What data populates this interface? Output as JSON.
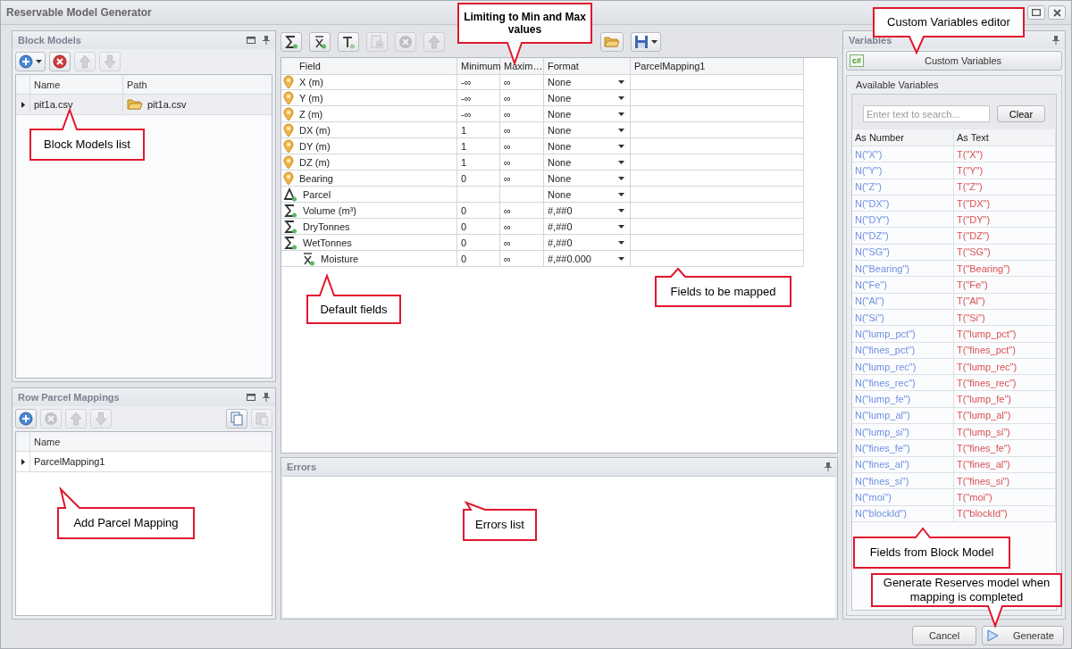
{
  "window": {
    "title": "Reservable Model Generator"
  },
  "block_models": {
    "title": "Block Models",
    "toolbar": [
      {
        "kind": "add",
        "dropdown": true,
        "disabled": false
      },
      {
        "kind": "delete",
        "disabled": false
      },
      {
        "kind": "up",
        "disabled": true
      },
      {
        "kind": "down",
        "disabled": true
      }
    ],
    "columns": [
      "Name",
      "Path"
    ],
    "rows": [
      {
        "name": "pit1a.csv",
        "path": "pit1a.csv",
        "selected": true
      }
    ]
  },
  "parcel_mappings": {
    "title": "Row Parcel Mappings",
    "toolbar": [
      {
        "kind": "add",
        "disabled": false
      },
      {
        "kind": "remove",
        "disabled": true
      },
      {
        "kind": "up",
        "disabled": true
      },
      {
        "kind": "down",
        "disabled": true
      },
      {
        "kind": "copy",
        "disabled": false
      },
      {
        "kind": "paste",
        "disabled": true
      }
    ],
    "columns": [
      "Name"
    ],
    "rows": [
      {
        "name": "ParcelMapping1",
        "selected": true
      }
    ]
  },
  "mapping_toolbar": [
    {
      "kind": "sigma",
      "disabled": false
    },
    {
      "kind": "formula",
      "disabled": false
    },
    {
      "kind": "text",
      "disabled": false
    },
    {
      "kind": "add-field",
      "disabled": true
    },
    {
      "kind": "remove",
      "disabled": true
    },
    {
      "kind": "up",
      "disabled": true
    },
    {
      "kind": "folder",
      "disabled": false
    },
    {
      "kind": "save",
      "dropdown": true,
      "disabled": false
    }
  ],
  "field_grid": {
    "columns": [
      "Field",
      "Minimum",
      "Maxim…",
      "Format",
      "ParcelMapping1"
    ],
    "rows": [
      {
        "kind": "location",
        "field": "X (m)",
        "minimum": "-∞",
        "maximum": "∞",
        "format": "None"
      },
      {
        "kind": "location",
        "field": "Y (m)",
        "minimum": "-∞",
        "maximum": "∞",
        "format": "None"
      },
      {
        "kind": "location",
        "field": "Z (m)",
        "minimum": "-∞",
        "maximum": "∞",
        "format": "None"
      },
      {
        "kind": "location",
        "field": "DX (m)",
        "minimum": "1",
        "maximum": "∞",
        "format": "None"
      },
      {
        "kind": "location",
        "field": "DY (m)",
        "minimum": "1",
        "maximum": "∞",
        "format": "None"
      },
      {
        "kind": "location",
        "field": "DZ (m)",
        "minimum": "1",
        "maximum": "∞",
        "format": "None"
      },
      {
        "kind": "location",
        "field": "Bearing",
        "minimum": "0",
        "maximum": "∞",
        "format": "None"
      },
      {
        "kind": "delta",
        "field": "Parcel",
        "format": "None"
      },
      {
        "kind": "sigma",
        "field": "Volume (m³)",
        "minimum": "0",
        "maximum": "∞",
        "format": "#,##0"
      },
      {
        "kind": "sigma",
        "field": "DryTonnes",
        "minimum": "0",
        "maximum": "∞",
        "format": "#,##0"
      },
      {
        "kind": "sigma",
        "field": "WetTonnes",
        "minimum": "0",
        "maximum": "∞",
        "format": "#,##0",
        "children": [
          {
            "kind": "formula",
            "field": "Moisture",
            "minimum": "0",
            "maximum": "∞",
            "format": "#,##0.000"
          }
        ]
      }
    ]
  },
  "errors": {
    "title": "Errors"
  },
  "variables": {
    "title": "Variables",
    "custom_button": "Custom Variables",
    "custom_button_icon": "c#",
    "available_title": "Available Variables",
    "search": {
      "placeholder": "Enter text to search..."
    },
    "clear_button": "Clear",
    "columns": [
      "As Number",
      "As Text"
    ],
    "rows": [
      {
        "number": "N(\"X\")",
        "text": "T(\"X\")"
      },
      {
        "number": "N(\"Y\")",
        "text": "T(\"Y\")"
      },
      {
        "number": "N(\"Z\")",
        "text": "T(\"Z\")"
      },
      {
        "number": "N(\"DX\")",
        "text": "T(\"DX\")"
      },
      {
        "number": "N(\"DY\")",
        "text": "T(\"DY\")"
      },
      {
        "number": "N(\"DZ\")",
        "text": "T(\"DZ\")"
      },
      {
        "number": "N(\"SG\")",
        "text": "T(\"SG\")"
      },
      {
        "number": "N(\"Bearing\")",
        "text": "T(\"Bearing\")"
      },
      {
        "number": "N(\"Fe\")",
        "text": "T(\"Fe\")"
      },
      {
        "number": "N(\"Al\")",
        "text": "T(\"Al\")"
      },
      {
        "number": "N(\"Si\")",
        "text": "T(\"Si\")"
      },
      {
        "number": "N(\"lump_pct\")",
        "text": "T(\"lump_pct\")"
      },
      {
        "number": "N(\"fines_pct\")",
        "text": "T(\"fines_pct\")"
      },
      {
        "number": "N(\"lump_rec\")",
        "text": "T(\"lump_rec\")"
      },
      {
        "number": "N(\"fines_rec\")",
        "text": "T(\"fines_rec\")"
      },
      {
        "number": "N(\"lump_fe\")",
        "text": "T(\"lump_fe\")"
      },
      {
        "number": "N(\"lump_al\")",
        "text": "T(\"lump_al\")"
      },
      {
        "number": "N(\"lump_si\")",
        "text": "T(\"lump_si\")"
      },
      {
        "number": "N(\"fines_fe\")",
        "text": "T(\"fines_fe\")"
      },
      {
        "number": "N(\"fines_al\")",
        "text": "T(\"fines_al\")"
      },
      {
        "number": "N(\"fines_si\")",
        "text": "T(\"fines_si\")"
      },
      {
        "number": "N(\"moi\")",
        "text": "T(\"moi\")"
      },
      {
        "number": "N(\"blockId\")",
        "text": "T(\"blockId\")"
      }
    ]
  },
  "footer": {
    "buttons": [
      {
        "label": "Cancel",
        "kind": "plain"
      },
      {
        "label": "Generate",
        "kind": "run"
      }
    ]
  },
  "callouts": [
    "Limiting to Min and Max values",
    "Custom Variables editor",
    "Block Models list",
    "Default fields",
    "Fields to be mapped",
    "Add Parcel Mapping",
    "Errors list",
    "Fields from Block Model",
    "Generate Reserves model when mapping is completed"
  ]
}
